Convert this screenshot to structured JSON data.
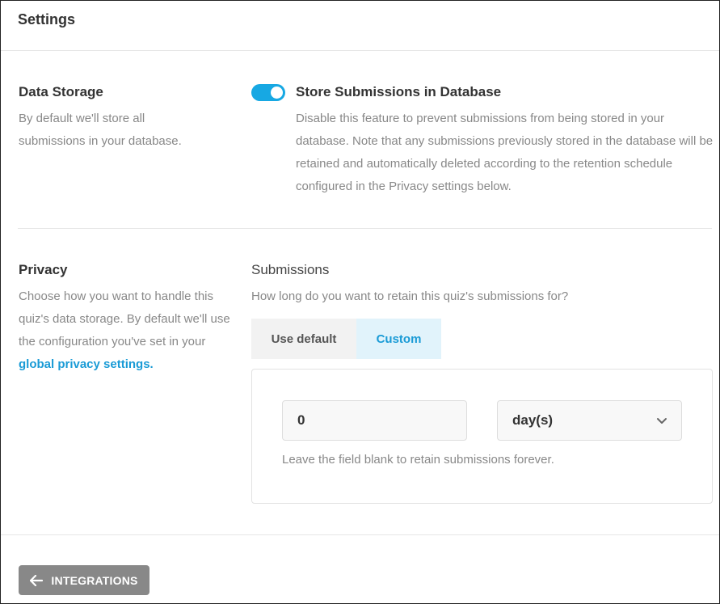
{
  "header": {
    "title": "Settings"
  },
  "data_storage": {
    "title": "Data Storage",
    "description": "By default we'll store all submissions in your database.",
    "toggle": {
      "enabled": true,
      "label": "Store Submissions in Database",
      "description": "Disable this feature to prevent submissions from being stored in your database. Note that any submissions previously stored in the database will be retained and automatically deleted according to the retention schedule configured in the Privacy settings below."
    }
  },
  "privacy": {
    "title": "Privacy",
    "description_prefix": "Choose how you want to handle this quiz's data storage. By default we'll use the configuration you've set in your",
    "description_link": "global privacy settings.",
    "submissions": {
      "title": "Submissions",
      "question": "How long do you want to retain this quiz's submissions for?",
      "tabs": [
        {
          "label": "Use default",
          "active": false
        },
        {
          "label": "Custom",
          "active": true
        }
      ],
      "retention_value": "0",
      "retention_unit": "day(s)",
      "help_text": "Leave the field blank to retain submissions forever."
    }
  },
  "footer": {
    "back_button_label": "INTEGRATIONS",
    "back_icon": "arrow-left-icon"
  },
  "colors": {
    "accent": "#17a8e3",
    "link": "#1a9bd6",
    "button_gray": "#888888"
  }
}
